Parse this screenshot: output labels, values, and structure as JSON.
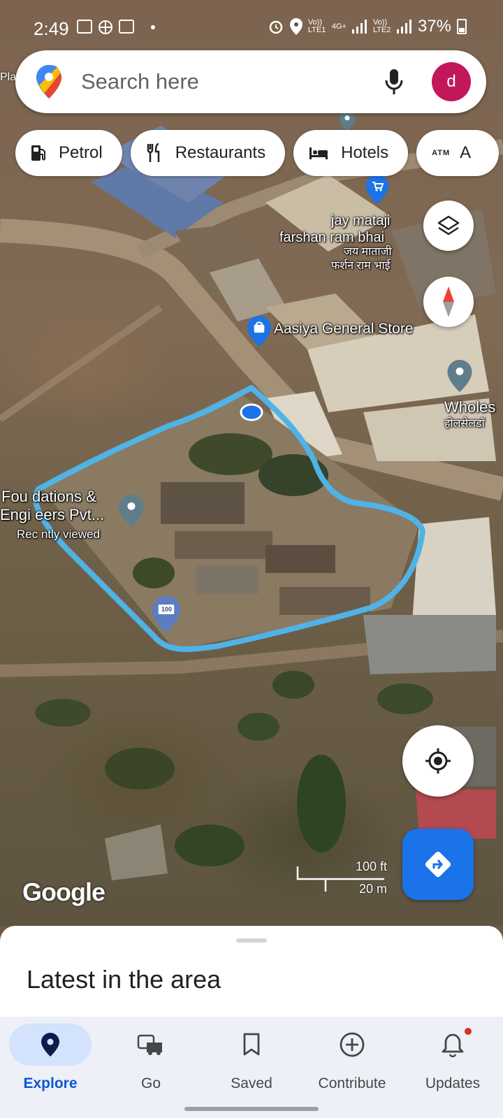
{
  "status_bar": {
    "time": "2:49",
    "network_left": "Vo)) LTE1",
    "network_mid": "4G+",
    "network_right": "Vo)) LTE2",
    "battery": "37%"
  },
  "search": {
    "placeholder": "Search here",
    "avatar_letter": "d",
    "avatar_color": "#c2185b",
    "left_cut_label": "Pla"
  },
  "chips": [
    {
      "label": "Petrol",
      "icon": "petrol-pump-icon"
    },
    {
      "label": "Restaurants",
      "icon": "fork-knife-icon"
    },
    {
      "label": "Hotels",
      "icon": "bed-icon"
    },
    {
      "label": "A",
      "prefix": "ATM",
      "icon": "atm-icon"
    }
  ],
  "map_labels": {
    "shop1_line1": "jay mataji",
    "shop1_line2": "farshan ram bhai",
    "shop1_hindi1": "जय माताजी",
    "shop1_hindi2": "फर्शन राम भाई",
    "store": "Aasiya General Store",
    "wholesale": "Wholes",
    "wholesale_hindi": "होलसेलडॉ",
    "company_line1": "Fou dations &",
    "company_line2": "Engi eers Pvt...",
    "recently": "Rec ntly viewed",
    "badge": "100"
  },
  "scale": {
    "feet": "100 ft",
    "meters": "20 m"
  },
  "branding": "Google",
  "sheet": {
    "title": "Latest in the area"
  },
  "nav": [
    {
      "label": "Explore",
      "icon": "pin-icon",
      "active": true
    },
    {
      "label": "Go",
      "icon": "car-icon",
      "active": false
    },
    {
      "label": "Saved",
      "icon": "bookmark-icon",
      "active": false
    },
    {
      "label": "Contribute",
      "icon": "plus-circle-icon",
      "active": false
    },
    {
      "label": "Updates",
      "icon": "bell-icon",
      "active": false,
      "notification_dot": true
    }
  ],
  "colors": {
    "accent": "#1a73e8",
    "nav_active": "#0b57d0",
    "outline": "#4fb3e8"
  }
}
